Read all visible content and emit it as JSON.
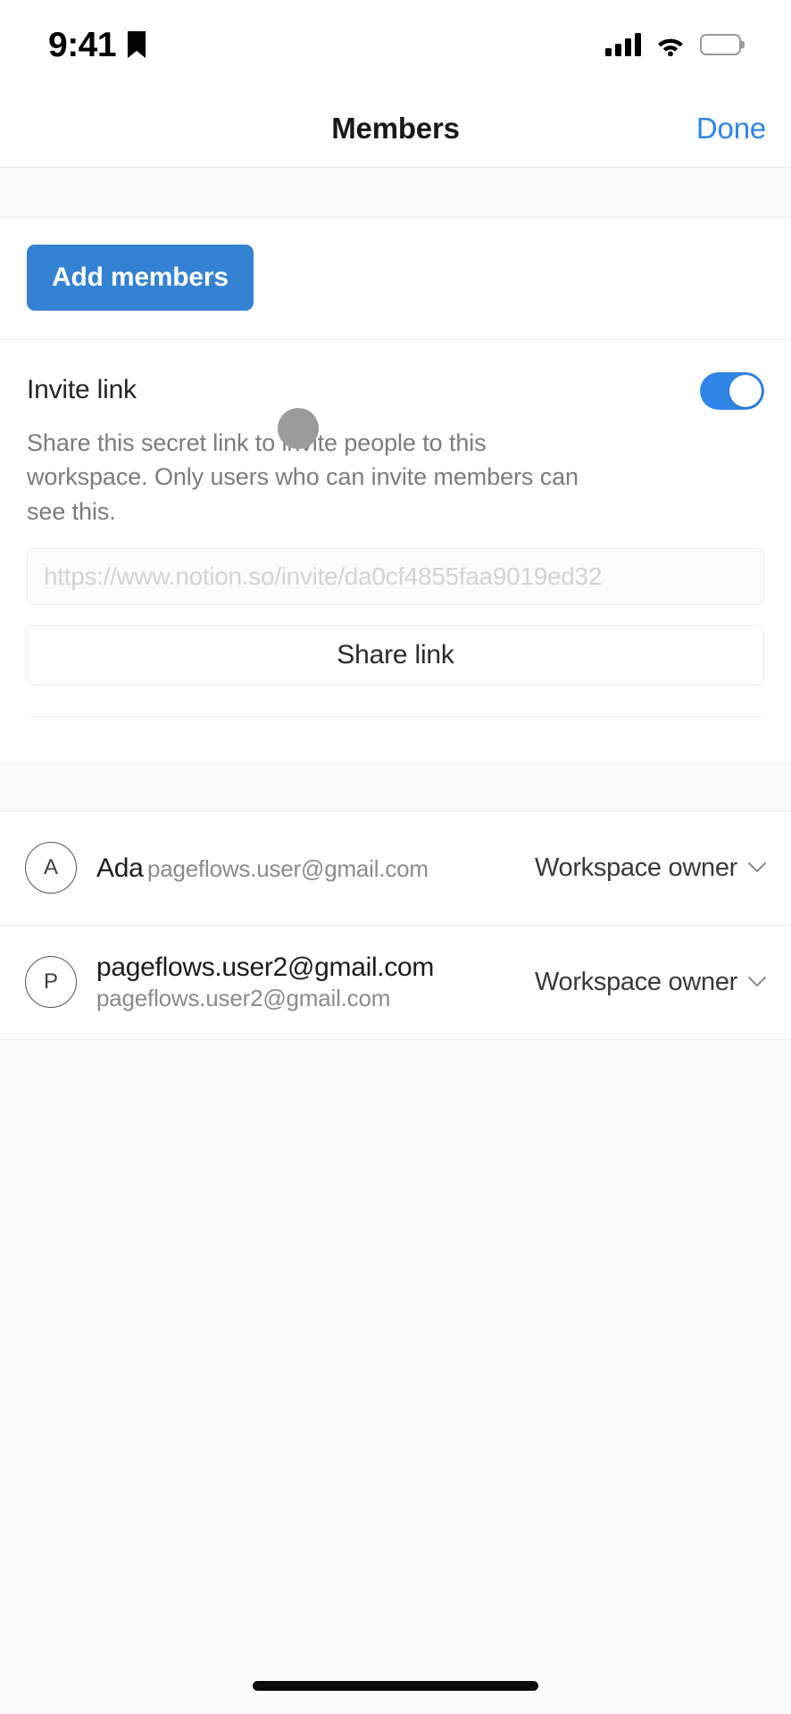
{
  "status_bar": {
    "time": "9:41",
    "icons": [
      "bookmark-icon",
      "cellular-signal-icon",
      "wifi-icon",
      "battery-icon"
    ],
    "battery_full": true
  },
  "nav": {
    "title": "Members",
    "done_label": "Done",
    "accent_color": "#2f86e8"
  },
  "add_members": {
    "button_label": "Add members",
    "button_color": "#3382d4"
  },
  "invite_link": {
    "title": "Invite link",
    "description": "Share this secret link to invite people to this workspace. Only users who can invite members can see this.",
    "toggle_on": true,
    "toggle_color": "#2f86e8",
    "url_value": "https://www.notion.so/invite/da0cf4855faa9019ed32",
    "share_button_label": "Share link"
  },
  "members": {
    "rows": [
      {
        "avatar_initial": "A",
        "name": "Ada",
        "email": "pageflows.user@gmail.com",
        "role": "Workspace owner"
      },
      {
        "avatar_initial": "P",
        "name": "pageflows.user2@gmail.com",
        "email": "pageflows.user2@gmail.com",
        "role": "Workspace owner"
      }
    ]
  }
}
